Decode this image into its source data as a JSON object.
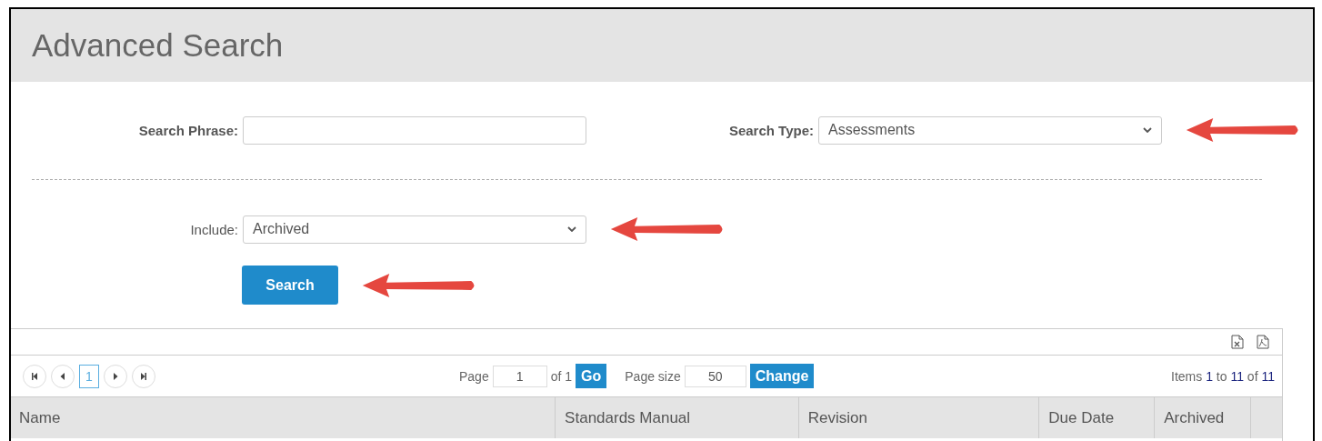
{
  "title": "Advanced Search",
  "search_phrase": {
    "label": "Search Phrase:"
  },
  "search_type": {
    "label": "Search Type:",
    "value": "Assessments",
    "annotated": true
  },
  "include": {
    "label": "Include:",
    "value": "Archived",
    "annotated": true
  },
  "search_button": {
    "label": "Search",
    "annotated": true
  },
  "grid": {
    "pager": {
      "pages": [
        {
          "label": "1",
          "selected": true
        }
      ],
      "page_label": "Page",
      "page_value": "1",
      "of_text": "of 1",
      "go": "Go",
      "size_label": "Page size",
      "size_value": "50",
      "change": "Change",
      "items_text": "Items **1** to **11** of **11**"
    },
    "columns": [
      {
        "label": "Name"
      },
      {
        "label": "Standards Manual"
      },
      {
        "label": "Revision"
      },
      {
        "label": "Due Date"
      },
      {
        "label": "Archived"
      },
      {}
    ]
  }
}
